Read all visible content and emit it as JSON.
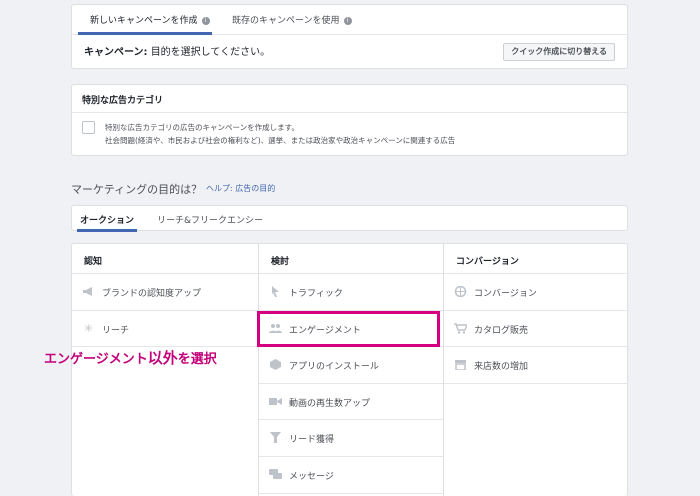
{
  "top_tabs": {
    "new_campaign": "新しいキャンペーンを作成",
    "existing_campaign": "既存のキャンペーンを使用",
    "info_glyph": "i"
  },
  "campaign": {
    "label": "キャンペーン:",
    "text": "目的を選択してください。",
    "switch_button": "クイック作成に切り替える"
  },
  "special_category": {
    "title": "特別な広告カテゴリ",
    "line1": "特別な広告カテゴリの広告のキャンペーンを作成します。",
    "line2": "社会問題(経済や、市民および社会の権利など)、選挙、または政治家や政治キャンペーンに関連する広告"
  },
  "marketing": {
    "title": "マーケティングの目的は？",
    "help": "ヘルプ: 広告の目的"
  },
  "objective_tabs": {
    "auction": "オークション",
    "reach_frequency": "リーチ&フリークエンシー"
  },
  "columns": {
    "awareness": {
      "header": "認知",
      "items": [
        {
          "label": "ブランドの認知度アップ",
          "icon": "megaphone-icon"
        },
        {
          "label": "リーチ",
          "icon": "reach-icon"
        }
      ]
    },
    "consideration": {
      "header": "検討",
      "items": [
        {
          "label": "トラフィック",
          "icon": "cursor-icon"
        },
        {
          "label": "エンゲージメント",
          "icon": "people-icon"
        },
        {
          "label": "アプリのインストール",
          "icon": "box-icon"
        },
        {
          "label": "動画の再生数アップ",
          "icon": "video-icon"
        },
        {
          "label": "リード獲得",
          "icon": "funnel-icon"
        },
        {
          "label": "メッセージ",
          "icon": "chat-icon"
        }
      ]
    },
    "conversion": {
      "header": "コンバージョン",
      "items": [
        {
          "label": "コンバージョン",
          "icon": "globe-icon"
        },
        {
          "label": "カタログ販売",
          "icon": "cart-icon"
        },
        {
          "label": "来店数の増加",
          "icon": "store-icon"
        }
      ]
    }
  },
  "annotation": {
    "prefix": "エンゲージメント",
    "emphasis": "以外",
    "suffix": "を選択"
  },
  "colors": {
    "accent": "#4267b2",
    "highlight": "#d4007f",
    "annotation": "#c4007a"
  }
}
